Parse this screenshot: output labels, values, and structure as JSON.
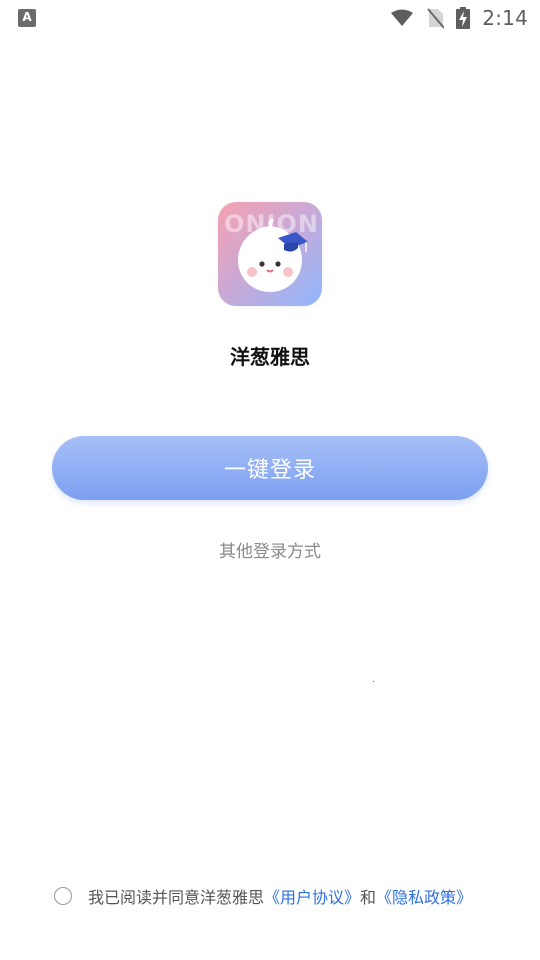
{
  "status_bar": {
    "time": "2:14",
    "left_icon": "A"
  },
  "app": {
    "logo_text": "ONION",
    "name": "洋葱雅思"
  },
  "login": {
    "primary_label": "一键登录",
    "other_label": "其他登录方式"
  },
  "agreement": {
    "prefix": "我已阅读并同意洋葱雅思",
    "user_agreement": "《用户协议》",
    "and": "和",
    "privacy_policy": "《隐私政策》"
  },
  "colors": {
    "button_top": "#a6bff7",
    "button_bottom": "#7c9ff0",
    "link": "#2f6fe4"
  }
}
